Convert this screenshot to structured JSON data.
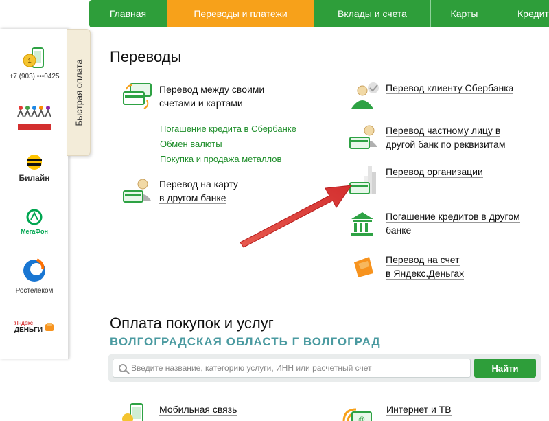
{
  "nav": {
    "items": [
      {
        "label": "Главная"
      },
      {
        "label": "Переводы и платежи",
        "active": true
      },
      {
        "label": "Вклады и счета"
      },
      {
        "label": "Карты"
      },
      {
        "label": "Кредиты"
      }
    ]
  },
  "left_panel": {
    "fast_pay_tab": "Быстрая оплата",
    "phone": "+7 (903) •••0425",
    "beeline": "Билайн",
    "megafon": "МегаФон",
    "rostelecom": "Ростелеком",
    "yandex_top": "Яндекс",
    "yandex_bottom": "ДЕНЬГИ"
  },
  "transfers": {
    "title": "Переводы",
    "own_accounts_l1": "Перевод между своими",
    "own_accounts_l2": "счетами и картами",
    "links": [
      "Погашение кредита в Сбербанке",
      "Обмен валюты",
      "Покупка и продажа металлов"
    ],
    "to_card_l1": "Перевод на карту",
    "to_card_l2": "в другом банке",
    "sber_client": "Перевод клиенту Сбербанка",
    "private_l1": "Перевод частному лицу в",
    "private_l2": "другой банк по реквизитам",
    "organization": "Перевод организации",
    "loans_l1": "Погашение кредитов в другом",
    "loans_l2": "банке",
    "yandex_l1": "Перевод на счет",
    "yandex_l2": "в Яндекс.Деньгах"
  },
  "payments": {
    "title": "Оплата покупок и услуг",
    "region": "ВОЛГОГРАДСКАЯ ОБЛАСТЬ Г ВОЛГОГРАД",
    "search_placeholder": "Введите название, категорию услуги, ИНН или расчетный счет",
    "search_button": "Найти",
    "mobile": "Мобильная связь",
    "internet": "Интернет и ТВ"
  },
  "colors": {
    "green": "#2e9e3a",
    "orange": "#f7a11a",
    "arrow": "#e0453c",
    "teal": "#4a9aa0"
  }
}
